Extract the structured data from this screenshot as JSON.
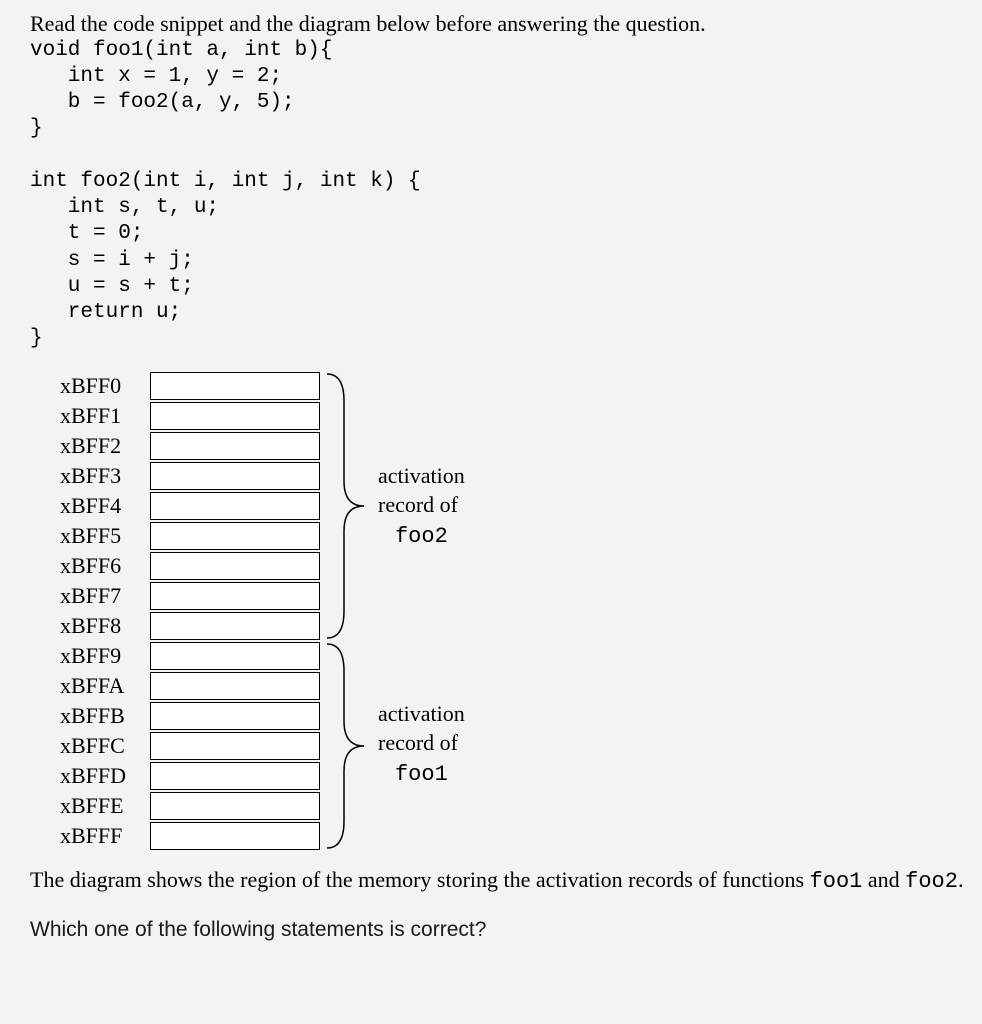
{
  "intro": "Read the code snippet and the diagram below before answering the question.",
  "code": "void foo1(int a, int b){\n   int x = 1, y = 2;\n   b = foo2(a, y, 5);\n}\n\nint foo2(int i, int j, int k) {\n   int s, t, u;\n   t = 0;\n   s = i + j;\n   u = s + t;\n   return u;\n}",
  "memory": {
    "addresses": [
      "xBFF0",
      "xBFF1",
      "xBFF2",
      "xBFF3",
      "xBFF4",
      "xBFF5",
      "xBFF6",
      "xBFF7",
      "xBFF8",
      "xBFF9",
      "xBFFA",
      "xBFFB",
      "xBFFC",
      "xBFFD",
      "xBFFE",
      "xBFFF"
    ]
  },
  "labels": {
    "top_line1": "activation",
    "top_line2": "record of",
    "top_line3": "foo2",
    "bot_line1": "activation",
    "bot_line2": "record of",
    "bot_line3": "foo1"
  },
  "caption_prefix": "The diagram shows the region of the memory storing the activation records of functions ",
  "caption_code1": "foo1",
  "caption_mid": " and  ",
  "caption_code2": "foo2",
  "caption_suffix": ".",
  "question": "Which one of the following statements is correct?"
}
